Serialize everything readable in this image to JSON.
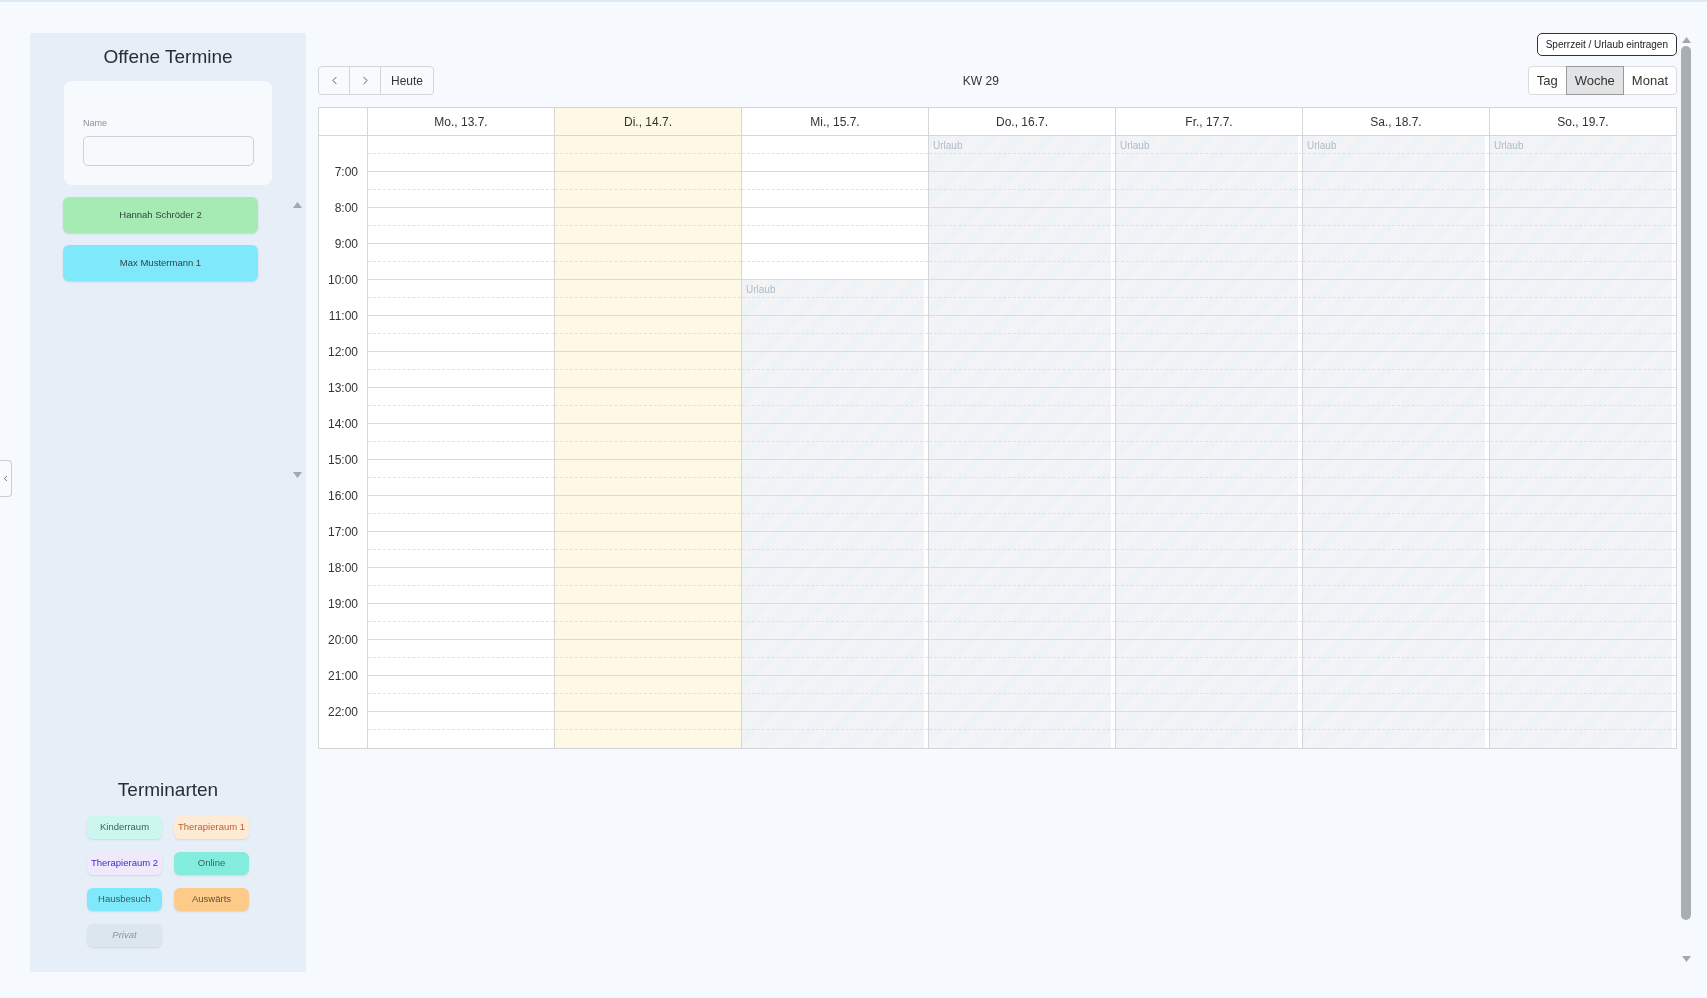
{
  "sidebar": {
    "title": "Offene Termine",
    "filter": {
      "label": "Name"
    },
    "patients": [
      {
        "name": "Hannah Schröder 2",
        "color": "#a6ebb3"
      },
      {
        "name": "Max Mustermann 1",
        "color": "#80e8fb"
      }
    ],
    "legend": {
      "title": "Terminarten",
      "types": [
        {
          "label": "Kinderraum",
          "kind": "normal",
          "color": "#ccf7ee"
        },
        {
          "label": "Therapieraum 1",
          "kind": "normal",
          "color": "#feebd6"
        },
        {
          "label": "Therapieraum 2",
          "kind": "normal",
          "color": "#f0e9fb"
        },
        {
          "label": "Online",
          "kind": "normal",
          "color": "#84ecdd"
        },
        {
          "label": "Hausbesuch",
          "kind": "normal",
          "color": "#80e8fb"
        },
        {
          "label": "Auswärts",
          "kind": "normal",
          "color": "#fdcb89"
        },
        {
          "label": "Privat",
          "kind": "private",
          "color": "#dce6ee"
        }
      ]
    }
  },
  "toolbar": {
    "block_button": "Sperrzeit / Urlaub eintragen",
    "today_button": "Heute",
    "week_label": "KW 29",
    "views": [
      {
        "label": "Tag",
        "selected": false
      },
      {
        "label": "Woche",
        "selected": true
      },
      {
        "label": "Monat",
        "selected": false
      }
    ]
  },
  "calendar": {
    "days": [
      {
        "label": "Mo., 13.7.",
        "today": false
      },
      {
        "label": "Di., 14.7.",
        "today": true
      },
      {
        "label": "Mi., 15.7.",
        "today": false,
        "blocks": [
          {
            "label": "Urlaub",
            "level": 0.765
          }
        ]
      },
      {
        "label": "Do., 16.7.",
        "today": false,
        "blocks": [
          {
            "label": "Urlaub",
            "level": 1
          }
        ]
      },
      {
        "label": "Fr., 17.7.",
        "today": false,
        "blocks": [
          {
            "label": "Urlaub",
            "level": 1
          }
        ]
      },
      {
        "label": "Sa., 18.7.",
        "today": false,
        "blocks": [
          {
            "label": "Urlaub",
            "level": 1
          }
        ]
      },
      {
        "label": "So., 19.7.",
        "today": false,
        "blocks": [
          {
            "label": "Urlaub",
            "level": 1
          }
        ]
      }
    ],
    "hours": [
      "7:00",
      "8:00",
      "9:00",
      "10:00",
      "11:00",
      "12:00",
      "13:00",
      "14:00",
      "15:00",
      "16:00",
      "17:00",
      "18:00",
      "19:00",
      "20:00",
      "21:00",
      "22:00"
    ]
  }
}
